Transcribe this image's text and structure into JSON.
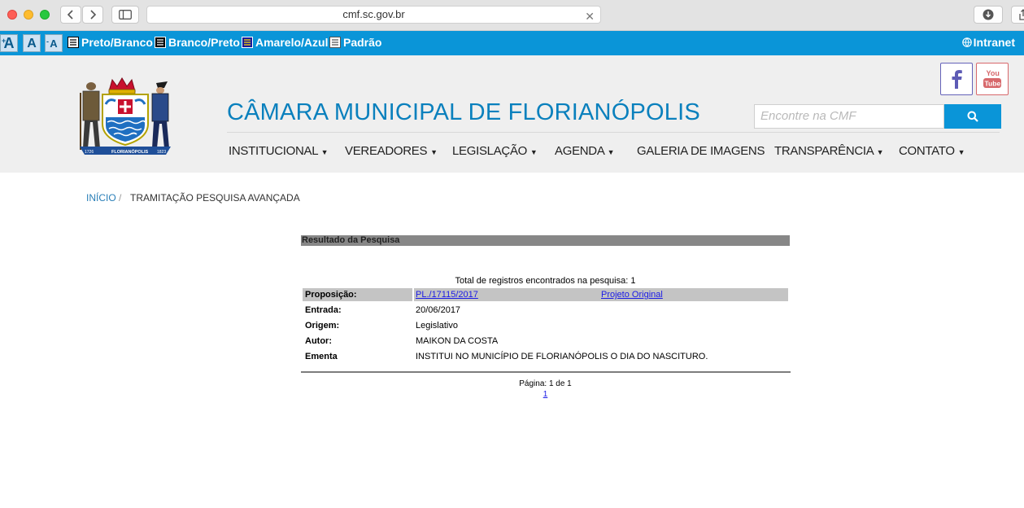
{
  "browser": {
    "url": "cmf.sc.gov.br"
  },
  "accessibility": {
    "font_increase": "A",
    "font_normal": "A",
    "font_decrease": "A",
    "contrast_options": [
      "Preto/Branco",
      "Branco/Preto",
      "Amarelo/Azul",
      "Padrão"
    ],
    "intranet": "Intranet"
  },
  "header": {
    "title": "CÂMARA MUNICIPAL DE FLORIANÓPOLIS",
    "search_placeholder": "Encontre na CMF",
    "social": {
      "youtube_top": "You",
      "youtube_bottom": "Tube"
    },
    "crest_text": {
      "left_year": "1726",
      "banner": "FLORIANÓPOLIS",
      "right_year": "1823"
    },
    "nav": [
      {
        "label": "INSTITUCIONAL",
        "dropdown": true
      },
      {
        "label": "VEREADORES",
        "dropdown": true
      },
      {
        "label": "LEGISLAÇÃO",
        "dropdown": true
      },
      {
        "label": "AGENDA",
        "dropdown": true
      },
      {
        "label": "GALERIA DE IMAGENS",
        "dropdown": false
      },
      {
        "label": "TRANSPARÊNCIA",
        "dropdown": true
      },
      {
        "label": "CONTATO",
        "dropdown": true
      }
    ],
    "colors": {
      "accent": "#0a95d8",
      "title": "#0a80bd"
    }
  },
  "breadcrumb": {
    "home": "INÍCIO",
    "separator": "/",
    "current": "TRAMITAÇÃO PESQUISA AVANÇADA"
  },
  "results": {
    "heading": "Resultado da Pesquisa",
    "total": "Total de registros encontrados na pesquisa: 1",
    "proposicao_label": "Proposição:",
    "proposicao_value": "PL./17115/2017",
    "original_link": "Projeto Original",
    "fields": [
      {
        "label": "Entrada:",
        "value": "20/06/2017"
      },
      {
        "label": "Origem:",
        "value": "Legislativo"
      },
      {
        "label": "Autor:",
        "value": "MAIKON DA COSTA"
      },
      {
        "label": "Ementa",
        "value": "INSTITUI NO MUNICÍPIO DE FLORIANÓPOLIS O DIA DO NASCITURO."
      }
    ],
    "pagination": "Página: 1 de 1",
    "page_link": "1"
  }
}
